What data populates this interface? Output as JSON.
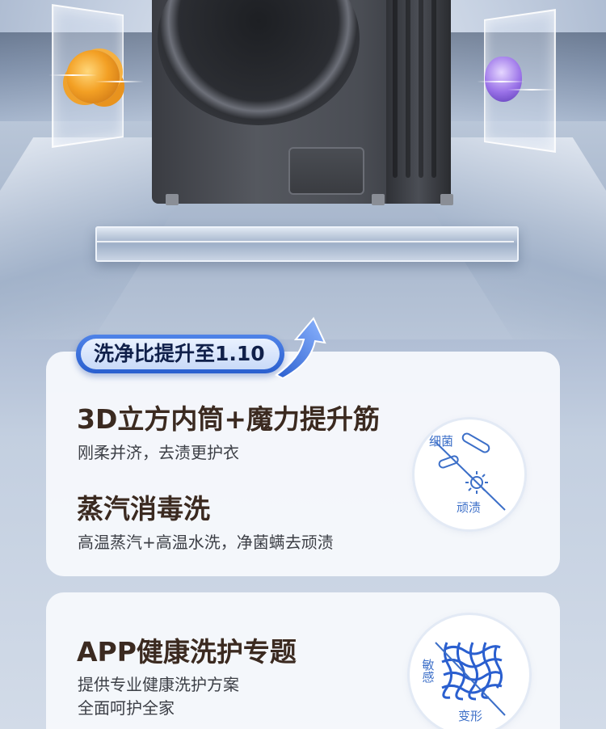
{
  "colors": {
    "badge_blue": "#2a5fcf",
    "title_brown": "#3b2a20",
    "icon_blue": "#3c6fc8"
  },
  "badge": {
    "text": "洗净比提升至1.10"
  },
  "features": [
    {
      "title": "3D立方内筒+魔力提升筋",
      "subtitle": "刚柔并济，去渍更护衣"
    },
    {
      "title": "蒸汽消毒洗",
      "subtitle": "高温蒸汽+高温水洗，净菌螨去顽渍"
    },
    {
      "title": "APP健康洗护专题",
      "subtitle_lines": [
        "提供专业健康洗护方案",
        "全面呵护全家"
      ]
    }
  ],
  "icon_circles": [
    {
      "icon": "bacteria-stain-icon",
      "labels": [
        "细菌",
        "顽渍"
      ]
    },
    {
      "icon": "fabric-mesh-icon",
      "labels": [
        "敏感",
        "变形"
      ]
    }
  ]
}
